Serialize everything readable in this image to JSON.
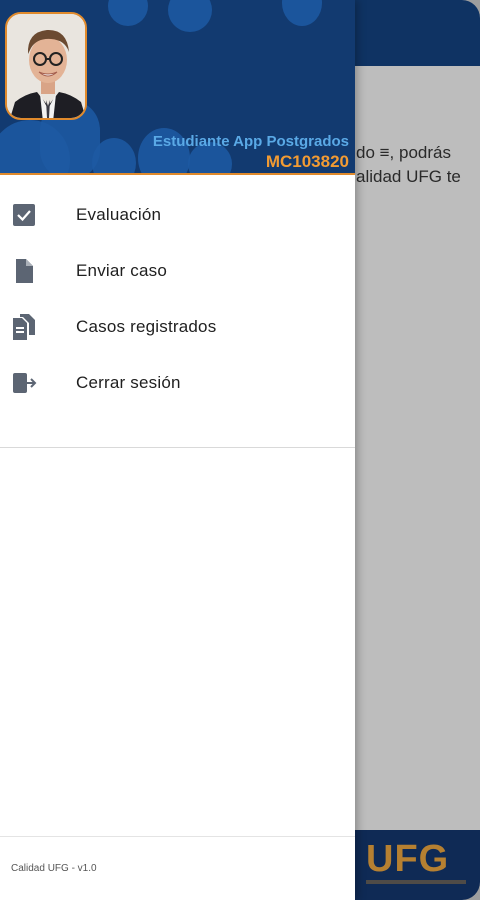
{
  "background": {
    "line1": "do ≡, podrás",
    "line2": "alidad UFG te",
    "logo_text": "UFG"
  },
  "drawer": {
    "user_name": "Estudiante App Postgrados",
    "user_code": "MC103820",
    "menu": [
      {
        "label": "Evaluación",
        "icon": "checkbox-checked-icon"
      },
      {
        "label": "Enviar caso",
        "icon": "document-icon"
      },
      {
        "label": "Casos registrados",
        "icon": "documents-icon"
      },
      {
        "label": "Cerrar sesión",
        "icon": "logout-icon"
      }
    ],
    "version": "Calidad UFG - v1.0"
  },
  "colors": {
    "header_bg": "#123a70",
    "accent_orange": "#f29b33",
    "name_blue": "#5aa9e6",
    "icon_gray": "#5c6573"
  }
}
